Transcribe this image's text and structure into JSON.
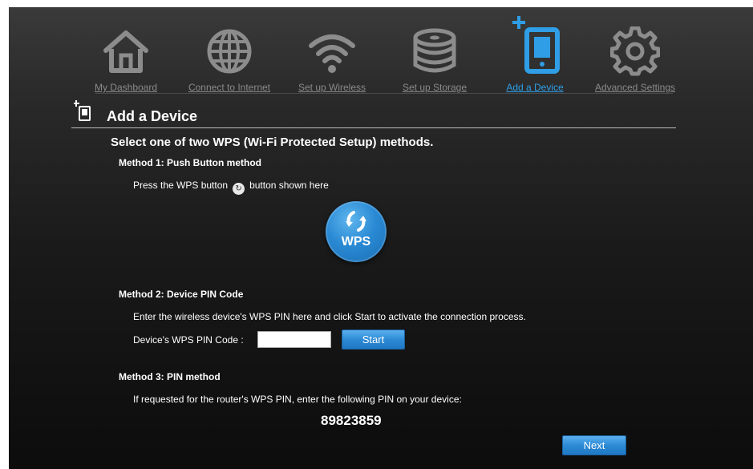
{
  "nav": {
    "items": [
      {
        "label": "My Dashboard",
        "icon": "home-icon"
      },
      {
        "label": "Connect to Internet",
        "icon": "globe-icon"
      },
      {
        "label": "Set up Wireless",
        "icon": "wifi-icon"
      },
      {
        "label": "Set up Storage",
        "icon": "storage-icon"
      },
      {
        "label": "Add a Device",
        "icon": "add-device-icon",
        "active": true
      },
      {
        "label": "Advanced Settings",
        "icon": "gear-icon"
      }
    ]
  },
  "page": {
    "title": "Add a Device",
    "subtitle": "Select one of two WPS (Wi-Fi Protected Setup) methods."
  },
  "method1": {
    "heading": "Method 1: Push Button method",
    "text_before": "Press the WPS button",
    "text_after": "button shown here",
    "button_label": "WPS"
  },
  "method2": {
    "heading": "Method 2: Device PIN Code",
    "instructions": "Enter the wireless device's WPS PIN here and click Start to activate the connection process.",
    "pin_label": "Device's WPS PIN Code :",
    "pin_value": "",
    "start_label": "Start"
  },
  "method3": {
    "heading": "Method 3: PIN method",
    "instructions": "If requested for the router's WPS PIN, enter the following PIN on your device:",
    "pin": "89823859"
  },
  "footer": {
    "next_label": "Next"
  },
  "colors": {
    "accent": "#2f9ee6",
    "icon_gray": "#8c8c8c",
    "button_blue": "#2d8ad5"
  }
}
